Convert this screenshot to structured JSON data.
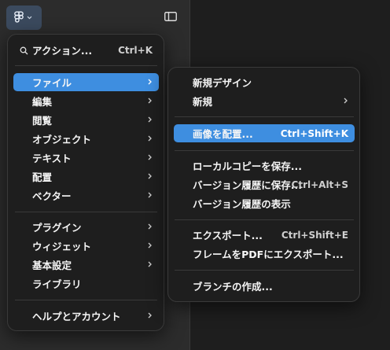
{
  "toolbar": {
    "logo_icon": "figma-logo-icon",
    "sidebar_icon": "sidebar-toggle-icon"
  },
  "main_menu": {
    "search": {
      "label": "アクション...",
      "shortcut": "Ctrl+K"
    },
    "items": [
      {
        "label": "ファイル",
        "submenu": true,
        "highlighted": true
      },
      {
        "label": "編集",
        "submenu": true
      },
      {
        "label": "閲覧",
        "submenu": true
      },
      {
        "label": "オブジェクト",
        "submenu": true
      },
      {
        "label": "テキスト",
        "submenu": true
      },
      {
        "label": "配置",
        "submenu": true
      },
      {
        "label": "ベクター",
        "submenu": true
      }
    ],
    "items2": [
      {
        "label": "プラグイン",
        "submenu": true
      },
      {
        "label": "ウィジェット",
        "submenu": true
      },
      {
        "label": "基本設定",
        "submenu": true
      },
      {
        "label": "ライブラリ",
        "submenu": false
      }
    ],
    "items3": [
      {
        "label": "ヘルプとアカウント",
        "submenu": true
      }
    ]
  },
  "file_submenu": {
    "group1": [
      {
        "label": "新規デザイン",
        "shortcut": ""
      },
      {
        "label": "新規",
        "submenu": true
      }
    ],
    "group2": [
      {
        "label": "画像を配置...",
        "shortcut": "Ctrl+Shift+K",
        "highlighted": true
      }
    ],
    "group3": [
      {
        "label": "ローカルコピーを保存...",
        "shortcut": ""
      },
      {
        "label": "バージョン履歴に保存...",
        "shortcut": "Ctrl+Alt+S"
      },
      {
        "label": "バージョン履歴の表示",
        "shortcut": ""
      }
    ],
    "group4": [
      {
        "label": "エクスポート...",
        "shortcut": "Ctrl+Shift+E"
      },
      {
        "label": "フレームをPDFにエクスポート...",
        "shortcut": ""
      }
    ],
    "group5": [
      {
        "label": "ブランチの作成...",
        "shortcut": ""
      }
    ]
  },
  "colors": {
    "highlight": "#3e8ee0",
    "menu_bg": "#1e1e1e",
    "panel_bg": "#2c2c2c",
    "logo_btn_bg": "#3b4a5e"
  }
}
